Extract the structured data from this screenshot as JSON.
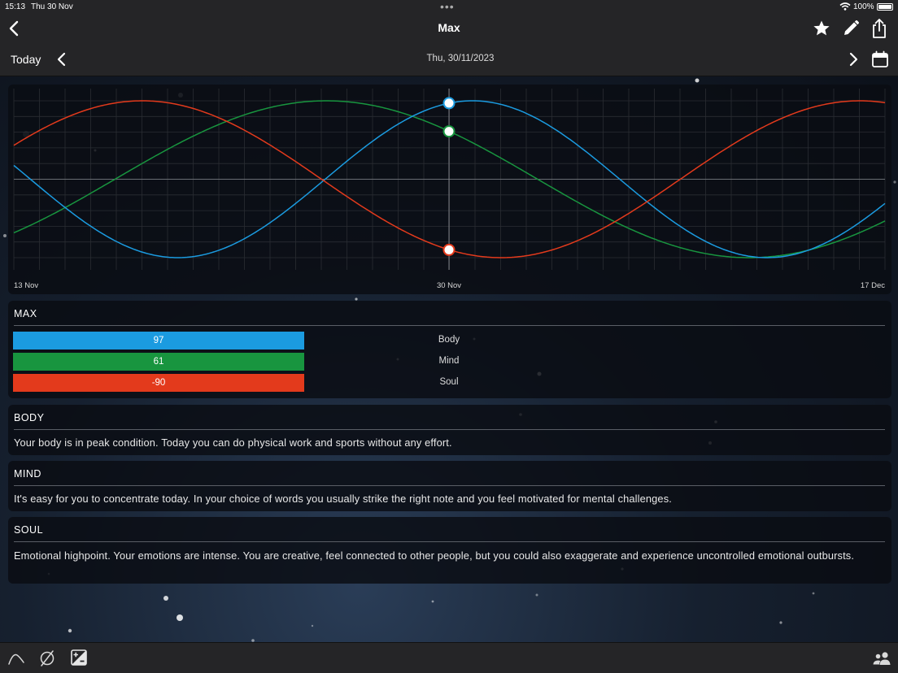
{
  "status_bar": {
    "time": "15:13",
    "date": "Thu 30 Nov",
    "battery": "100%"
  },
  "nav": {
    "title": "Max"
  },
  "date_bar": {
    "today_label": "Today",
    "date": "Thu, 30/11/2023"
  },
  "colors": {
    "body": "#1b9be0",
    "mind": "#18953f",
    "soul": "#e33a1c"
  },
  "icons": {
    "back": "chevron-left-icon",
    "favorite": "star-icon",
    "edit": "pencil-icon",
    "share": "share-icon",
    "prev_day": "chevron-left-icon",
    "next_day": "chevron-right-icon",
    "calendar": "calendar-icon",
    "tab_curve": "curve-icon",
    "tab_empty": "empty-set-icon",
    "tab_plusminus": "plus-minus-icon",
    "tab_people": "people-icon"
  },
  "chart_data": {
    "type": "line",
    "x_tick_labels": [
      "13 Nov",
      "30 Nov",
      "17 Dec"
    ],
    "x": [
      "13 Nov",
      "17 Dec"
    ],
    "today": "30 Nov",
    "ylim": [
      -100,
      100
    ],
    "grid": true,
    "series": [
      {
        "name": "Body",
        "period_days": 23,
        "value_today": 97
      },
      {
        "name": "Mind",
        "period_days": 33,
        "value_today": 61
      },
      {
        "name": "Soul",
        "period_days": 28,
        "value_today": -90
      }
    ]
  },
  "max_section": {
    "heading": "MAX",
    "rows": [
      {
        "label": "Body",
        "value": "97"
      },
      {
        "label": "Mind",
        "value": "61"
      },
      {
        "label": "Soul",
        "value": "-90"
      }
    ]
  },
  "sections": {
    "body": {
      "heading": "BODY",
      "text": "Your body is in peak condition. Today you can do physical work and sports without any effort."
    },
    "mind": {
      "heading": "MIND",
      "text": "It's easy for you to concentrate today. In your choice of words you usually strike the right note and you feel motivated for mental challenges."
    },
    "soul": {
      "heading": "SOUL",
      "text": "Emotional highpoint. Your emotions are intense. You are creative, feel connected to other people, but you could also exaggerate and experience uncontrolled emotional outbursts."
    }
  }
}
